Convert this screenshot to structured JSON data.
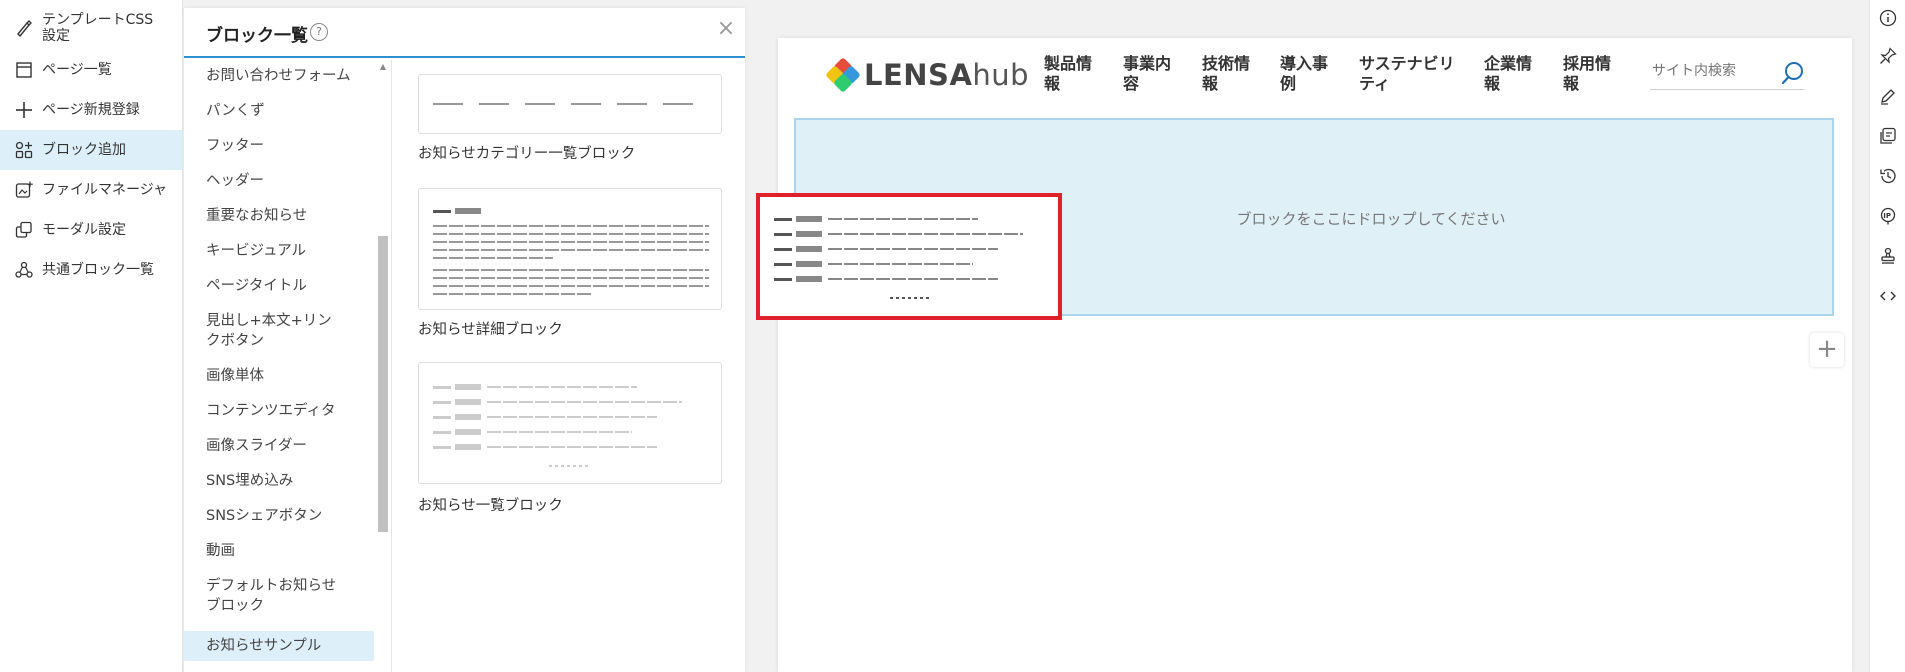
{
  "sidebar": {
    "items": [
      {
        "label": "テンプレートCSS設定",
        "icon": "brush-icon"
      },
      {
        "label": "ページ一覧",
        "icon": "page-list-icon"
      },
      {
        "label": "ページ新規登録",
        "icon": "plus-icon"
      },
      {
        "label": "ブロック追加",
        "icon": "add-block-icon",
        "active": true
      },
      {
        "label": "ファイルマネージャ",
        "icon": "file-manager-icon"
      },
      {
        "label": "モーダル設定",
        "icon": "modal-icon"
      },
      {
        "label": "共通ブロック一覧",
        "icon": "shared-blocks-icon"
      }
    ]
  },
  "panel": {
    "title": "ブロック一覧",
    "help": "?",
    "close": "×",
    "categories": [
      "お問い合わせフォーム",
      "パンくず",
      "フッター",
      "ヘッダー",
      "重要なお知らせ",
      "キービジュアル",
      "ページタイトル",
      "見出し+本文+リンクボタン",
      "画像単体",
      "コンテンツエディタ",
      "画像スライダー",
      "SNS埋め込み",
      "SNSシェアボタン",
      "動画",
      "デフォルトお知らせブロック",
      "お知らせサンプル"
    ],
    "active_category": "お知らせサンプル",
    "templates": [
      "お知らせカテゴリー一覧ブロック",
      "お知らせ詳細ブロック",
      "お知らせ一覧ブロック"
    ]
  },
  "site": {
    "logo": {
      "main": "LENSA",
      "sub": "hub"
    },
    "nav": [
      "製品情報",
      "事業内容",
      "技術情報",
      "導入事例",
      "サステナビリティ",
      "企業情報",
      "採用情報"
    ],
    "search_placeholder": "サイト内検索"
  },
  "canvas": {
    "drop_text": "ブロックをここにドロップしてください",
    "add_button": "+"
  },
  "rail": {
    "icons": [
      "info-icon",
      "pin-icon",
      "pen-icon",
      "layers-icon",
      "history-icon",
      "ip-icon",
      "stamp-icon",
      "code-icon"
    ]
  },
  "colors": {
    "accent": "#2b8fd1",
    "active_bg": "#ddeff8",
    "drop_bg": "#dff0f7",
    "highlight": "#e0202b"
  }
}
